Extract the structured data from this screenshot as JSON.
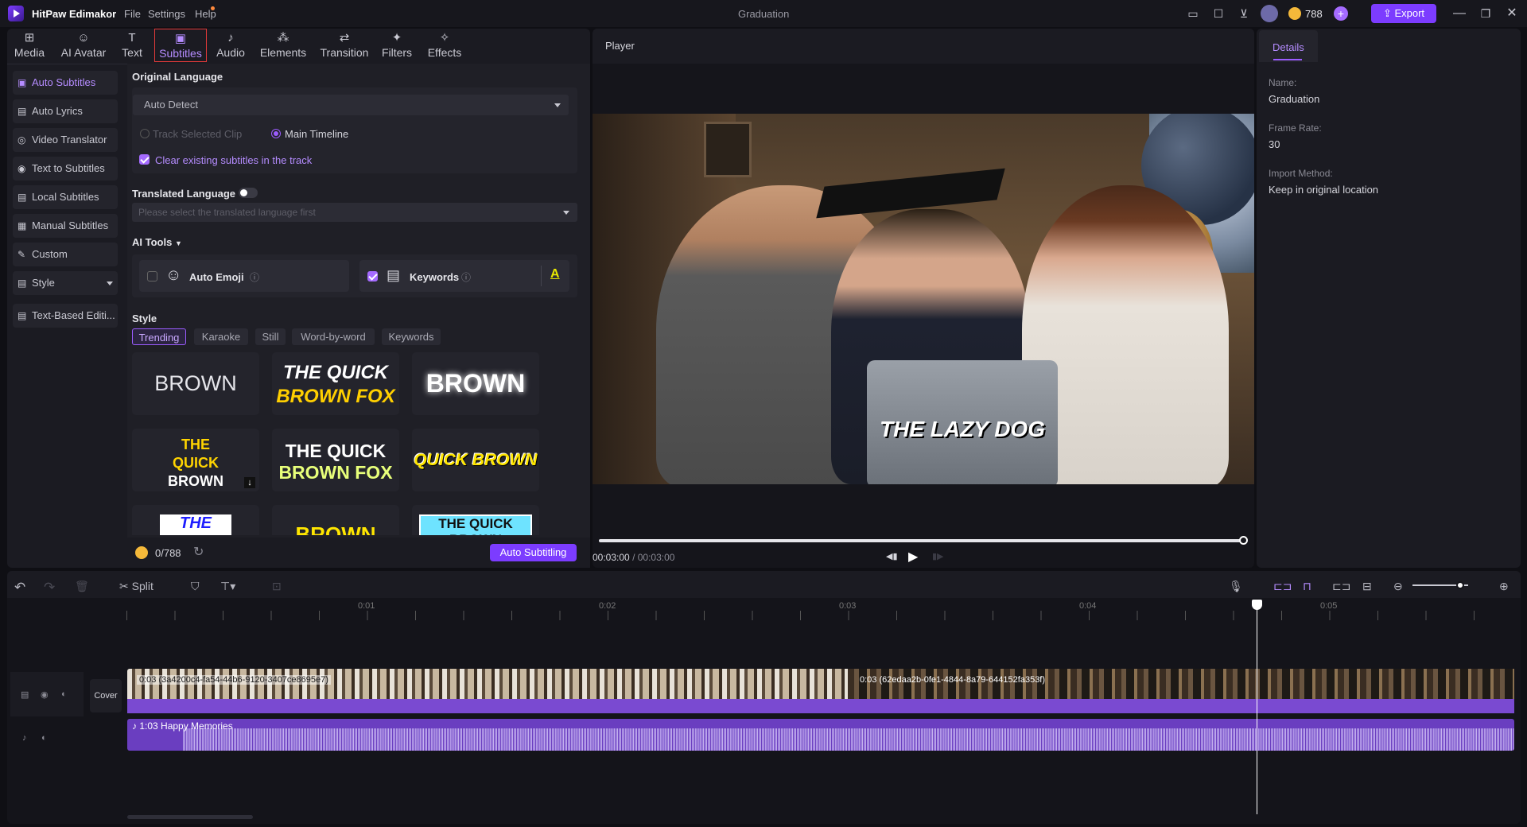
{
  "app": {
    "name": "HitPaw Edimakor",
    "menu": [
      "File",
      "Settings",
      "Help"
    ],
    "project_title": "Graduation",
    "credits": "788",
    "export_label": "Export"
  },
  "toolbar": {
    "tabs": [
      {
        "label": "Media",
        "icon": "media-icon"
      },
      {
        "label": "AI Avatar",
        "icon": "avatar-icon"
      },
      {
        "label": "Text",
        "icon": "text-icon"
      },
      {
        "label": "Subtitles",
        "icon": "subtitles-icon"
      },
      {
        "label": "Audio",
        "icon": "audio-icon"
      },
      {
        "label": "Elements",
        "icon": "elements-icon"
      },
      {
        "label": "Transition",
        "icon": "transition-icon"
      },
      {
        "label": "Filters",
        "icon": "filters-icon"
      },
      {
        "label": "Effects",
        "icon": "effects-icon"
      }
    ]
  },
  "sidebar": {
    "items": [
      {
        "label": "Auto Subtitles"
      },
      {
        "label": "Auto Lyrics"
      },
      {
        "label": "Video Translator"
      },
      {
        "label": "Text to Subtitles"
      },
      {
        "label": "Local Subtitles"
      },
      {
        "label": "Manual Subtitles"
      },
      {
        "label": "Custom"
      },
      {
        "label": "Style"
      },
      {
        "label": "Text-Based Editi..."
      }
    ]
  },
  "subtitles": {
    "original_language_title": "Original Language",
    "language_value": "Auto Detect",
    "radio_track": "Track Selected Clip",
    "radio_main": "Main Timeline",
    "clear_label": "Clear existing subtitles in the track",
    "translated_title": "Translated Language",
    "translated_placeholder": "Please select the translated language first",
    "ai_tools_title": "AI Tools",
    "auto_emoji": "Auto Emoji",
    "keywords": "Keywords",
    "style_title": "Style",
    "style_tabs": [
      "Trending",
      "Karaoke",
      "Still",
      "Word-by-word",
      "Keywords"
    ],
    "thumbs": [
      "BROWN",
      "THE QUICK",
      "BROWN FOX",
      "BROWN",
      "THE",
      "QUICK",
      "BROWN",
      "THE QUICK",
      "BROWN FOX",
      "QUICK BROWN",
      "THE QUICK",
      "BROWN",
      "THE QUICK BROWN"
    ],
    "credits_used": "0/788",
    "auto_button": "Auto Subtitling"
  },
  "player": {
    "title": "Player",
    "caption": "THE LAZY DOG",
    "time_current": "00:03:00",
    "time_total": "00:03:00",
    "separator": "/"
  },
  "details": {
    "tab": "Details",
    "name_label": "Name:",
    "name_value": "Graduation",
    "frame_rate_label": "Frame Rate:",
    "frame_rate_value": "30",
    "import_label": "Import Method:",
    "import_value": "Keep in original location"
  },
  "timeline": {
    "split_label": "Split",
    "ruler": [
      "0:01",
      "0:02",
      "0:03",
      "0:04",
      "0:05"
    ],
    "cover_label": "Cover",
    "clip1": "0:03 (3a4200c4-fa54-44b6-9120-3407ce8695e7)",
    "clip2": "0:03 (62edaa2b-0fe1-4844-8a79-644152fa353f)",
    "audio_clip": "1:03 Happy Memories",
    "zoom_level": 0.85
  },
  "colors": {
    "accent": "#7c3cff",
    "active": "#b58cff",
    "audio": "#7a4ad1"
  }
}
